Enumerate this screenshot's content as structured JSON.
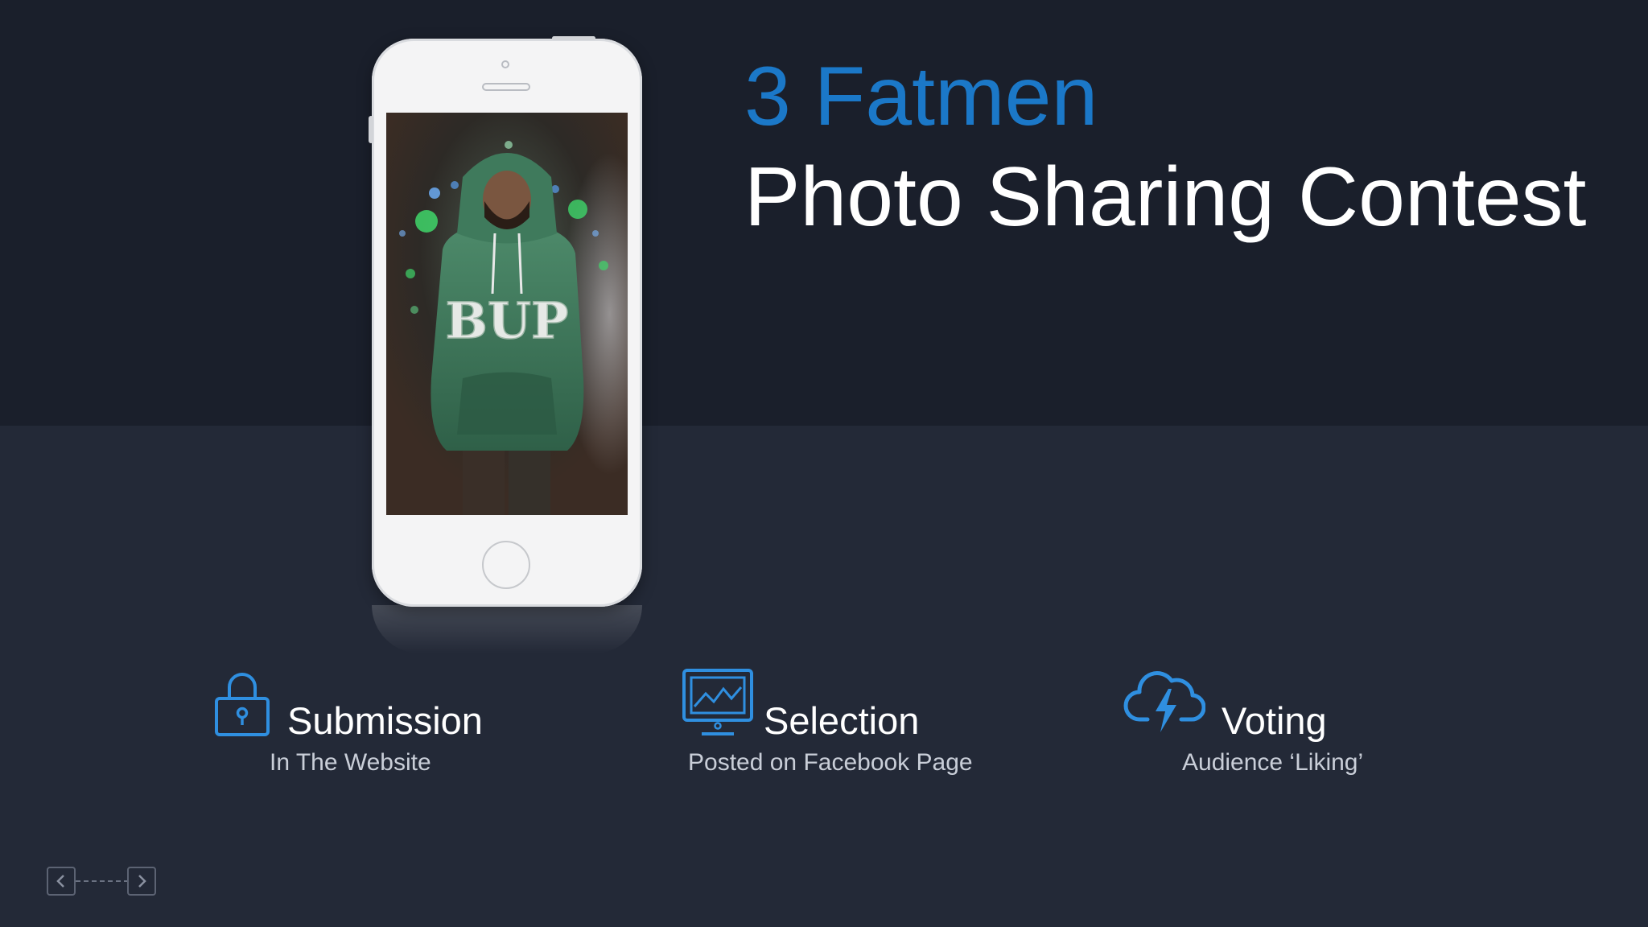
{
  "title": {
    "line1": "3 Fatmen",
    "line2": "Photo Sharing Contest"
  },
  "features": [
    {
      "icon": "lock-icon",
      "title": "Submission",
      "subtitle": "In The Website"
    },
    {
      "icon": "monitor-chart-icon",
      "title": "Selection",
      "subtitle": "Posted on Facebook Page"
    },
    {
      "icon": "cloud-lightning-icon",
      "title": "Voting",
      "subtitle": "Audience ‘Liking’"
    }
  ],
  "phone_photo": {
    "sweatshirt_text": "BUP"
  },
  "colors": {
    "accent": "#1b78c8",
    "background_top": "#1a1f2b",
    "background_bottom": "#232937",
    "icon_blue": "#2f8fe0"
  },
  "nav": {
    "prev_icon": "chevron-left-icon",
    "next_icon": "chevron-right-icon"
  }
}
